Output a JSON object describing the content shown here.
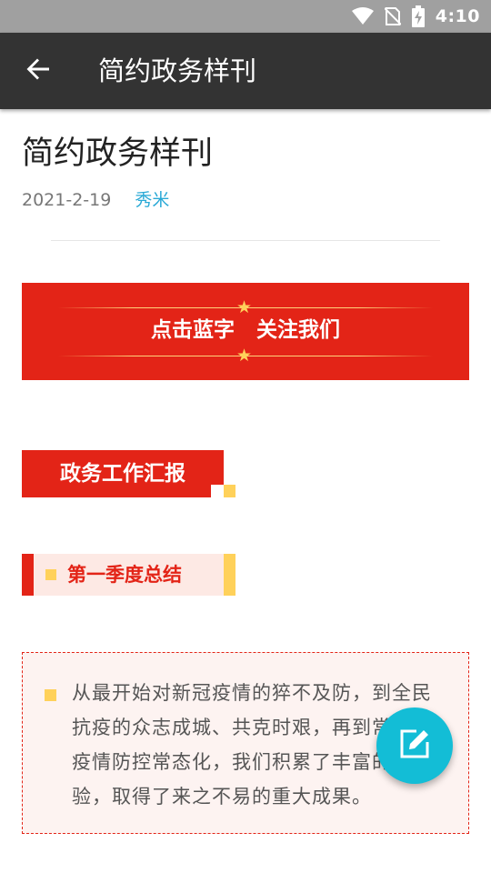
{
  "status_bar": {
    "time": "4:10",
    "icons": [
      "wifi-icon",
      "no-sim-icon",
      "battery-charging-icon"
    ]
  },
  "toolbar": {
    "back_icon": "arrow-back-icon",
    "title": "简约政务样刊"
  },
  "article": {
    "title": "简约政务样刊",
    "date": "2021-2-19",
    "author": "秀米"
  },
  "banner": {
    "text": "点击蓝字   关注我们",
    "icon": "star-icon"
  },
  "section": {
    "heading": "政务工作汇报"
  },
  "subsection": {
    "heading": "第一季度总结"
  },
  "content": {
    "paragraph": "从最开始对新冠疫情的猝不及防，到全民抗疫的众志成城、共克时艰，再到常态化疫情防控常态化，我们积累了丰富的经验，取得了来之不易的重大成果。"
  },
  "fab": {
    "icon": "edit-icon"
  },
  "colors": {
    "accent_red": "#e32417",
    "accent_yellow": "#ffd15a",
    "fab_cyan": "#13bdd6",
    "author_blue": "#2aa9d6",
    "toolbar_dark": "#333333"
  }
}
